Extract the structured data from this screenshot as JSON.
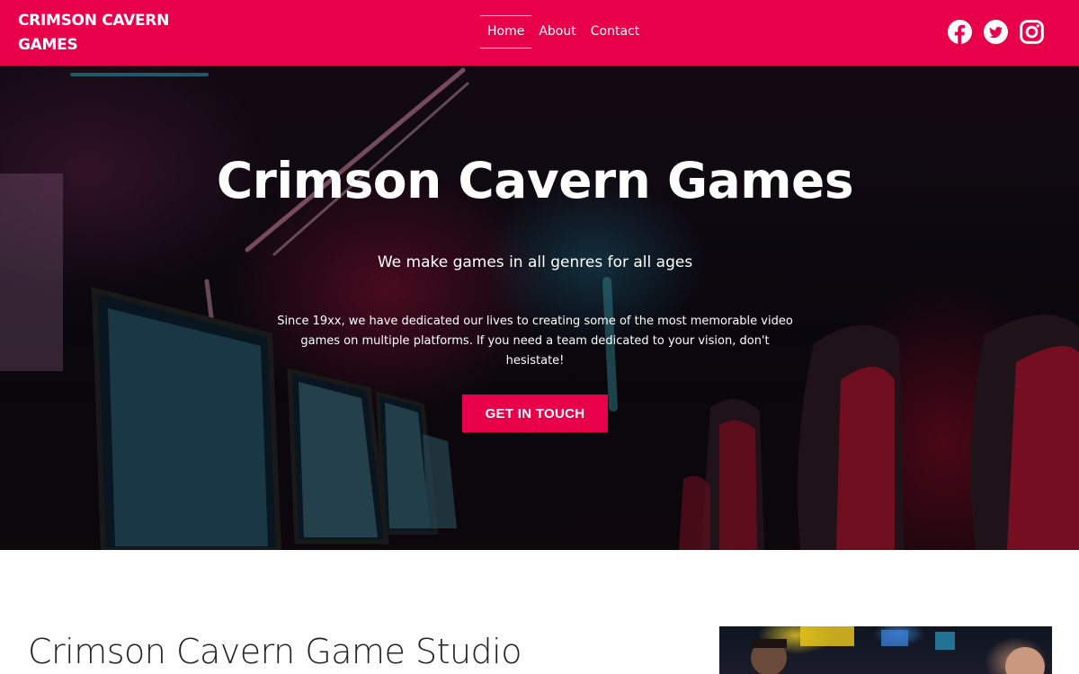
{
  "navbar": {
    "brand": "CRIMSON CAVERN GAMES",
    "links": [
      {
        "label": "Home",
        "active": true
      },
      {
        "label": "About",
        "active": false
      },
      {
        "label": "Contact",
        "active": false
      }
    ],
    "social": [
      "facebook-icon",
      "twitter-icon",
      "instagram-icon"
    ],
    "color": "#e8004b"
  },
  "hero": {
    "title": "Crimson Cavern Games",
    "subtitle": "We make games in all genres for all ages",
    "text": "Since 19xx, we have dedicated our lives to creating some of the most memorable video games on multiple platforms. If you need a team dedicated to your vision, don't hesistate!",
    "cta_label": "GET IN TOUCH"
  },
  "studio": {
    "title": "Crimson Cavern Game Studio"
  }
}
